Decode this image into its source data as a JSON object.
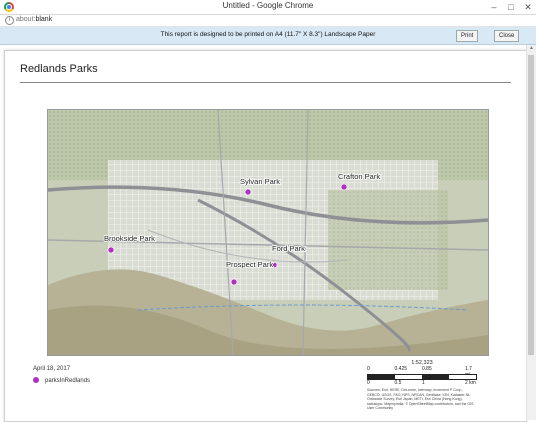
{
  "window": {
    "title": "Untitled - Google Chrome"
  },
  "address": {
    "prefix": "about:",
    "path": "blank"
  },
  "notice": {
    "message": "This report is designed to be printed on A4 (11.7\" X 8.3\") Landscape Paper",
    "print_label": "Print",
    "close_label": "Close"
  },
  "report": {
    "title": "Redlands Parks",
    "date": "April 18, 2017",
    "legend_label": "parksInRedlands",
    "point_color": "#b12fc4",
    "parks": [
      {
        "name": "Sylvan Park"
      },
      {
        "name": "Crafton Park"
      },
      {
        "name": "Brookside Park"
      },
      {
        "name": "Ford Park"
      },
      {
        "name": "Prospect Park"
      }
    ],
    "scale": {
      "ratio": "1:52,323",
      "mi_ticks": [
        "0",
        "0.425",
        "0.85",
        "1.7 mi"
      ],
      "km_ticks": [
        "0",
        "0.5",
        "1",
        "2 km"
      ]
    },
    "attribution": "Sources: Esri, HERE, DeLorme, Intermap, increment P Corp., GEBCO, USGS, FAO, NPS, NRCAN, GeoBase, IGN, Kadaster NL, Ordnance Survey, Esri Japan, METI, Esri China (Hong Kong), swisstopo, MapmyIndia, © OpenStreetMap contributors, and the GIS User Community"
  }
}
